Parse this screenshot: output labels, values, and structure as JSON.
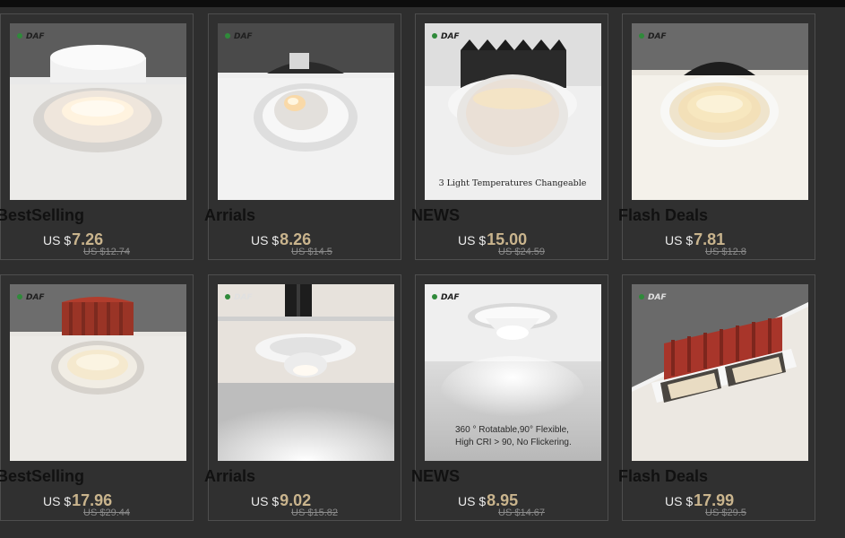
{
  "logo_text": "DAF",
  "accent_color": "#c9b48d",
  "products": [
    {
      "category": "BestSelling",
      "currency": "US $",
      "price": "7.26",
      "original_price": "US $12.74",
      "caption": ""
    },
    {
      "category": "Arrials",
      "currency": "US $",
      "price": "8.26",
      "original_price": "US $14.5",
      "caption": ""
    },
    {
      "category": "NEWS",
      "currency": "US $",
      "price": "15.00",
      "original_price": "US $24.59",
      "caption": "3 Light Temperatures Changeable"
    },
    {
      "category": "Flash Deals",
      "currency": "US $",
      "price": "7.81",
      "original_price": "US $12.8",
      "caption": ""
    },
    {
      "category": "BestSelling",
      "currency": "US $",
      "price": "17.96",
      "original_price": "US $29.44",
      "caption": ""
    },
    {
      "category": "Arrials",
      "currency": "US $",
      "price": "9.02",
      "original_price": "US $15.82",
      "caption": ""
    },
    {
      "category": "NEWS",
      "currency": "US $",
      "price": "8.95",
      "original_price": "US $14.67",
      "caption_line1": "360 ° Rotatable,90° Flexible,",
      "caption_line2": "High CRI > 90, No Flickering."
    },
    {
      "category": "Flash Deals",
      "currency": "US $",
      "price": "17.99",
      "original_price": "US $29.5",
      "caption": ""
    }
  ]
}
